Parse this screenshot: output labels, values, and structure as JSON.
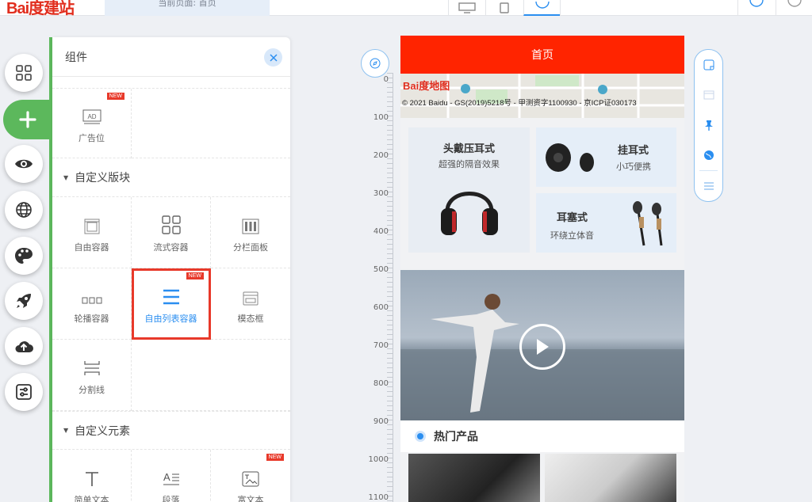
{
  "header": {
    "logo_text": "Bai度建站",
    "page_tab": "当前页面: 首页",
    "devices": [
      "desktop-icon",
      "tablet-icon",
      "mobile-icon"
    ],
    "active_device": "mobile-icon"
  },
  "rail": {
    "items": [
      "apps-icon",
      "plus-icon",
      "eye-icon",
      "globe-icon",
      "palette-icon",
      "rocket-icon",
      "cloud-upload-icon",
      "settings-sliders-icon"
    ],
    "active": "plus-icon"
  },
  "panel": {
    "title": "组件",
    "top_items": [
      {
        "label": "广告位",
        "icon": "ad-icon",
        "new": "NEW"
      }
    ],
    "section1": "自定义版块",
    "section1_items": [
      {
        "label": "自由容器",
        "icon": "free-container-icon"
      },
      {
        "label": "流式容器",
        "icon": "flow-container-icon"
      },
      {
        "label": "分栏面板",
        "icon": "column-panel-icon"
      },
      {
        "label": "轮播容器",
        "icon": "carousel-icon"
      },
      {
        "label": "自由列表容器",
        "icon": "list-icon",
        "new": "NEW",
        "selected": true
      },
      {
        "label": "模态框",
        "icon": "modal-icon"
      },
      {
        "label": "分割线",
        "icon": "divider-icon"
      }
    ],
    "section2": "自定义元素",
    "section2_items": [
      {
        "label": "简单文本",
        "icon": "text-icon"
      },
      {
        "label": "段落",
        "icon": "paragraph-icon"
      },
      {
        "label": "富文本",
        "icon": "rich-text-icon",
        "new": "NEW"
      }
    ]
  },
  "ruler": {
    "ticks": [
      "0",
      "100",
      "200",
      "300",
      "400",
      "500",
      "600",
      "700",
      "800",
      "900",
      "1000",
      "1100"
    ]
  },
  "preview": {
    "header": "首页",
    "map_logo": "Bai度地图",
    "map_copyright": "© 2021 Baidu - GS(2019)5218号 - 甲测资字1100930 - 京ICP证030173",
    "products": [
      {
        "title": "头戴压耳式",
        "subtitle": "超强的隔音效果"
      },
      {
        "title": "挂耳式",
        "subtitle": "小巧便携"
      },
      {
        "title": "耳塞式",
        "subtitle": "环绕立体音"
      }
    ],
    "hot_title": "热门产品"
  },
  "colors": {
    "accent": "#2a8ef0",
    "brand_red": "#ff2400",
    "highlight": "#e8392a",
    "green": "#5cb85c"
  }
}
